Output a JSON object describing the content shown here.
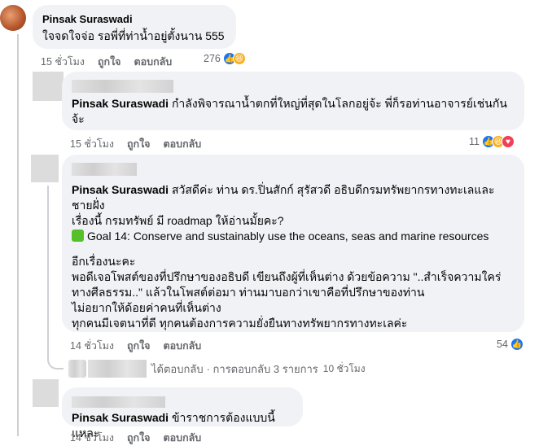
{
  "comments": [
    {
      "author": "Pinsak Suraswadi",
      "text": "ใจจดใจจ่อ รอพี่ที่ท่าน้ำอยู่ตั้งนาน 555",
      "time": "15 ชั่วโมง",
      "like": "ถูกใจ",
      "reply": "ตอบกลับ",
      "reaction_count": "276"
    },
    {
      "author": "Pinsak Suraswadi",
      "text": "กำลังพิจารณาน้ำตกที่ใหญ่ที่สุดในโลกอยู่จ้ะ พี่ก็รอท่านอาจารย์เช่นกัน",
      "text2": "จ้ะ",
      "time": "15 ชั่วโมง",
      "like": "ถูกใจ",
      "reply": "ตอบกลับ",
      "reaction_count": "11"
    },
    {
      "author": "Pinsak Suraswadi",
      "line1": "สวัสดีค่ะ ท่าน ดร.ปิ่นสักก์ สุรัสวดี อธิบดีกรมทรัพยากรทางทะเลและ",
      "line2": "ชายฝั่ง",
      "line3": "เรื่องนี้ กรมทรัพย์ มี roadmap ให้อ่านมั้ยคะ?",
      "line4": "Goal 14: Conserve and sustainably use the oceans, seas and marine resources",
      "line5": "อีกเรื่องนะคะ",
      "line6": "พอดีเจอโพสต์ของที่ปรึกษาของอธิบดี เขียนถึงผู้ที่เห็นต่าง ด้วยข้อความ \"..สำเร็จความใคร่",
      "line7": "ทางศีลธรรม..\" แล้วในโพสต์ต่อมา ท่านมาบอกว่าเขาคือที่ปรึกษาของท่าน",
      "line8": "ไม่อยากให้ด้อยค่าคนที่เห็นต่าง",
      "line9": "ทุกคนมีเจตนาที่ดี ทุกคนต้องการความยั่งยืนทางทรัพยากรทางทะเลค่ะ",
      "time": "14 ชั่วโมง",
      "like": "ถูกใจ",
      "reply": "ตอบกลับ",
      "reaction_count": "54"
    },
    {
      "author": "Pinsak Suraswadi",
      "text": "ข้าราชการต้องแบบนี้แหละ",
      "time": "14 ชั่วโมง",
      "like": "ถูกใจ",
      "reply": "ตอบกลับ"
    }
  ],
  "replies_summary": {
    "replied": "ได้ตอบกลับ",
    "count_text": "· การตอบกลับ 3 รายการ",
    "time": "10 ชั่วโมง"
  },
  "colors": {
    "like": "#1877f2",
    "haha": "#f7b125",
    "love": "#f33e58",
    "bubble": "#f0f2f5"
  }
}
